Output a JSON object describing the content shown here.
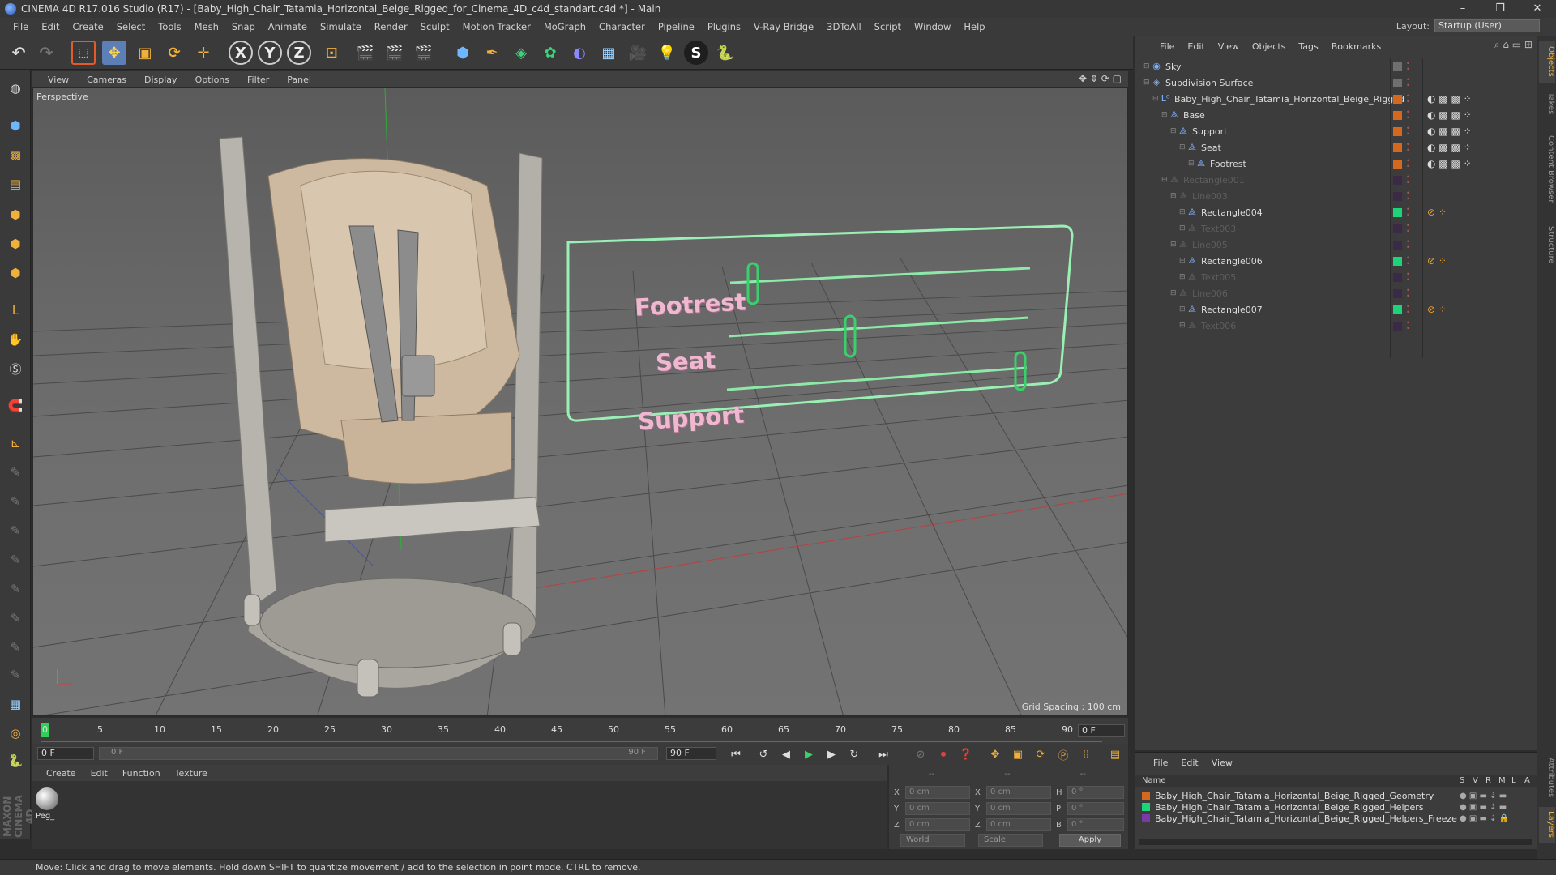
{
  "window": {
    "title": "CINEMA 4D R17.016 Studio (R17) - [Baby_High_Chair_Tatamia_Horizontal_Beige_Rigged_for_Cinema_4D_c4d_standart.c4d *] - Main",
    "controls": [
      "–",
      "❐",
      "✕"
    ]
  },
  "menu": {
    "items": [
      "File",
      "Edit",
      "Create",
      "Select",
      "Tools",
      "Mesh",
      "Snap",
      "Animate",
      "Simulate",
      "Render",
      "Sculpt",
      "Motion Tracker",
      "MoGraph",
      "Character",
      "Pipeline",
      "Plugins",
      "V-Ray Bridge",
      "3DToAll",
      "Script",
      "Window",
      "Help"
    ],
    "layout_label": "Layout:",
    "layout_value": "Startup (User)"
  },
  "toolbar": {
    "axis_x": "X",
    "axis_y": "Y",
    "axis_z": "Z"
  },
  "viewport": {
    "menu": [
      "View",
      "Cameras",
      "Display",
      "Options",
      "Filter",
      "Panel"
    ],
    "label": "Perspective",
    "grid_spacing": "Grid Spacing : 100 cm",
    "hud": {
      "footrest": "Footrest",
      "seat": "Seat",
      "support": "Support"
    }
  },
  "timeline": {
    "ticks": [
      "0",
      "5",
      "10",
      "15",
      "20",
      "25",
      "30",
      "35",
      "40",
      "45",
      "50",
      "55",
      "60",
      "65",
      "70",
      "75",
      "80",
      "85",
      "90"
    ],
    "current_frame": "0 F",
    "start_field": "0 F",
    "range_start": "0 F",
    "range_end": "90 F",
    "end_field": "90 F"
  },
  "materials": {
    "menu": [
      "Create",
      "Edit",
      "Function",
      "Texture"
    ],
    "items": [
      {
        "name": "Peg_"
      }
    ]
  },
  "coordinates": {
    "headers": [
      "--",
      "--",
      "--"
    ],
    "rows": [
      {
        "a": "X",
        "av": "0 cm",
        "b": "X",
        "bv": "0 cm",
        "c": "H",
        "cv": "0 °"
      },
      {
        "a": "Y",
        "av": "0 cm",
        "b": "Y",
        "bv": "0 cm",
        "c": "P",
        "cv": "0 °"
      },
      {
        "a": "Z",
        "av": "0 cm",
        "b": "Z",
        "bv": "0 cm",
        "c": "B",
        "cv": "0 °"
      }
    ],
    "mode": "World",
    "type": "Scale",
    "apply": "Apply"
  },
  "status": "Move: Click and drag to move elements. Hold down SHIFT to quantize movement / add to the selection in point mode, CTRL to remove.",
  "branding": "MAXON CINEMA 4D",
  "objects": {
    "menu": [
      "File",
      "Edit",
      "View",
      "Objects",
      "Tags",
      "Bookmarks"
    ],
    "items": [
      {
        "name": "Sky",
        "indent": 0,
        "dim": false,
        "color": "#6f6f6f",
        "icon": "sky-icon"
      },
      {
        "name": "Subdivision Surface",
        "indent": 0,
        "dim": false,
        "color": "#6f6f6f",
        "icon": "subdivision-icon"
      },
      {
        "name": "Baby_High_Chair_Tatamia_Horizontal_Beige_Rigged",
        "indent": 1,
        "dim": false,
        "color": "#d2691e",
        "icon": "null-icon"
      },
      {
        "name": "Base",
        "indent": 2,
        "dim": false,
        "color": "#d2691e",
        "icon": "joint-icon"
      },
      {
        "name": "Support",
        "indent": 3,
        "dim": false,
        "color": "#d2691e",
        "icon": "joint-icon"
      },
      {
        "name": "Seat",
        "indent": 4,
        "dim": false,
        "color": "#d2691e",
        "icon": "joint-icon"
      },
      {
        "name": "Footrest",
        "indent": 5,
        "dim": false,
        "color": "#d2691e",
        "icon": "joint-icon"
      },
      {
        "name": "Rectangle001",
        "indent": 2,
        "dim": true,
        "color": "#3a2a48",
        "icon": "spline-icon"
      },
      {
        "name": "Line003",
        "indent": 3,
        "dim": true,
        "color": "#3a2a48",
        "icon": "spline-icon"
      },
      {
        "name": "Rectangle004",
        "indent": 4,
        "dim": false,
        "color": "#1ed27a",
        "icon": "spline-icon"
      },
      {
        "name": "Text003",
        "indent": 4,
        "dim": true,
        "color": "#3a2a48",
        "icon": "text-icon"
      },
      {
        "name": "Line005",
        "indent": 3,
        "dim": true,
        "color": "#3a2a48",
        "icon": "spline-icon"
      },
      {
        "name": "Rectangle006",
        "indent": 4,
        "dim": false,
        "color": "#1ed27a",
        "icon": "spline-icon"
      },
      {
        "name": "Text005",
        "indent": 4,
        "dim": true,
        "color": "#3a2a48",
        "icon": "text-icon"
      },
      {
        "name": "Line006",
        "indent": 3,
        "dim": true,
        "color": "#3a2a48",
        "icon": "spline-icon"
      },
      {
        "name": "Rectangle007",
        "indent": 4,
        "dim": false,
        "color": "#1ed27a",
        "icon": "spline-icon"
      },
      {
        "name": "Text006",
        "indent": 4,
        "dim": true,
        "color": "#3a2a48",
        "icon": "text-icon"
      }
    ]
  },
  "layers": {
    "menu": [
      "File",
      "Edit",
      "View"
    ],
    "header_name": "Name",
    "header_cols": [
      "S",
      "V",
      "R",
      "M",
      "L",
      "A"
    ],
    "items": [
      {
        "name": "Baby_High_Chair_Tatamia_Horizontal_Beige_Rigged_Geometry",
        "color": "#d2691e"
      },
      {
        "name": "Baby_High_Chair_Tatamia_Horizontal_Beige_Rigged_Helpers",
        "color": "#1ed27a"
      },
      {
        "name": "Baby_High_Chair_Tatamia_Horizontal_Beige_Rigged_Helpers_Freeze",
        "color": "#7a3aa8"
      }
    ]
  },
  "side_tabs": [
    "Objects",
    "Takes",
    "Content Browser",
    "Structure",
    "Attributes",
    "Layers"
  ]
}
